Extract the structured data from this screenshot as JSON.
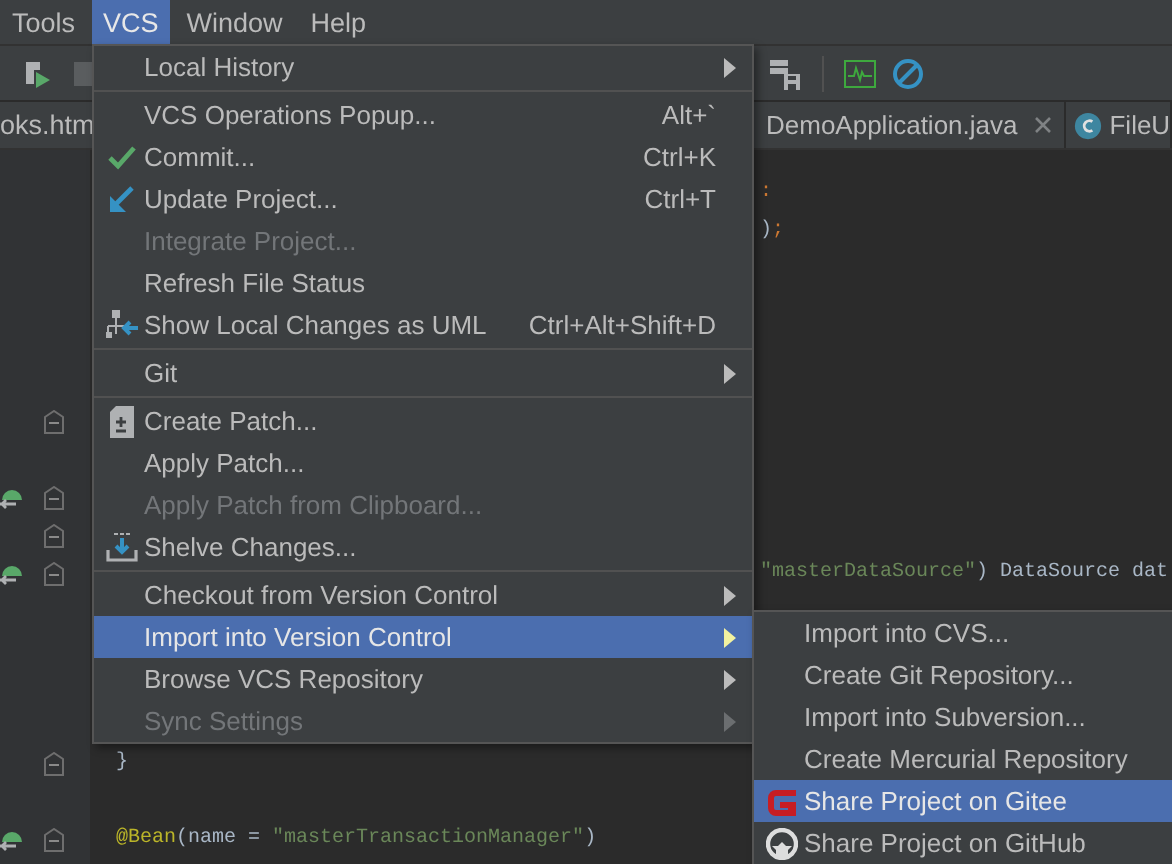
{
  "menubar": [
    {
      "label": "Tools",
      "selected": false
    },
    {
      "label": "VCS",
      "selected": true
    },
    {
      "label": "Window",
      "selected": false
    },
    {
      "label": "Help",
      "selected": false
    }
  ],
  "tabs": [
    {
      "label": "oks.htm",
      "selected": false,
      "kind": "file"
    },
    {
      "label": "DemoApplication.java",
      "selected": false,
      "closable": true,
      "kind": "file"
    },
    {
      "label": "FileU",
      "selected": false,
      "kind": "class"
    }
  ],
  "editor": {
    "lines": [
      {
        "kind": "plain",
        "right": [
          {
            "text": ":",
            "kind": "keyword"
          }
        ]
      },
      {
        "kind": "plain",
        "right": [
          {
            "text": ")",
            "kind": "plain"
          },
          {
            "text": ";",
            "kind": "keyword"
          }
        ]
      },
      {
        "kind": "plain"
      },
      {
        "kind": "plain"
      },
      {
        "kind": "plain"
      },
      {
        "kind": "plain"
      },
      {
        "kind": "fold"
      },
      {
        "kind": "plain"
      },
      {
        "kind": "bean"
      },
      {
        "kind": "fold"
      },
      {
        "kind": "bean",
        "right": [
          {
            "text": "\"masterDataSource\"",
            "kind": "string"
          },
          {
            "text": ") DataSource dat",
            "kind": "plain"
          }
        ]
      },
      {
        "kind": "plain"
      },
      {
        "kind": "plain"
      },
      {
        "kind": "plain"
      },
      {
        "kind": "plain"
      },
      {
        "kind": "fold",
        "left": [
          {
            "text": "}",
            "kind": "plain"
          }
        ]
      },
      {
        "kind": "plain"
      },
      {
        "kind": "bean",
        "left": [
          {
            "text": "@Bean",
            "kind": "annotation"
          },
          {
            "text": "(name = ",
            "kind": "plain"
          },
          {
            "text": "\"masterTransactionManager\"",
            "kind": "string"
          },
          {
            "text": ")",
            "kind": "plain"
          }
        ]
      }
    ]
  },
  "menu": {
    "items": [
      {
        "kind": "plain",
        "label": "Local History",
        "submenu": true,
        "disabled": false,
        "selected": false
      },
      {
        "kind": "separator"
      },
      {
        "kind": "plain",
        "label": "VCS Operations Popup...",
        "shortcut": "Alt+`",
        "submenu": false,
        "disabled": false,
        "selected": false
      },
      {
        "kind": "check",
        "label": "Commit...",
        "shortcut": "Ctrl+K",
        "submenu": false,
        "disabled": false,
        "selected": false
      },
      {
        "kind": "arrow",
        "label": "Update Project...",
        "shortcut": "Ctrl+T",
        "submenu": false,
        "disabled": false,
        "selected": false
      },
      {
        "kind": "plain",
        "label": "Integrate Project...",
        "submenu": false,
        "disabled": true,
        "selected": false
      },
      {
        "kind": "plain",
        "label": "Refresh File Status",
        "submenu": false,
        "disabled": false,
        "selected": false
      },
      {
        "kind": "diagram",
        "label": "Show Local Changes as UML",
        "shortcut": "Ctrl+Alt+Shift+D",
        "submenu": false,
        "disabled": false,
        "selected": false
      },
      {
        "kind": "separator"
      },
      {
        "kind": "plain",
        "label": "Git",
        "submenu": true,
        "disabled": false,
        "selected": false
      },
      {
        "kind": "separator"
      },
      {
        "kind": "patch",
        "label": "Create Patch...",
        "submenu": false,
        "disabled": false,
        "selected": false
      },
      {
        "kind": "plain",
        "label": "Apply Patch...",
        "submenu": false,
        "disabled": false,
        "selected": false
      },
      {
        "kind": "plain",
        "label": "Apply Patch from Clipboard...",
        "submenu": false,
        "disabled": true,
        "selected": false
      },
      {
        "kind": "shelve",
        "label": "Shelve Changes...",
        "submenu": false,
        "disabled": false,
        "selected": false
      },
      {
        "kind": "separator"
      },
      {
        "kind": "plain",
        "label": "Checkout from Version Control",
        "submenu": true,
        "disabled": false,
        "selected": false
      },
      {
        "kind": "plain",
        "label": "Import into Version Control",
        "submenu": true,
        "disabled": false,
        "selected": true
      },
      {
        "kind": "plain",
        "label": "Browse VCS Repository",
        "submenu": true,
        "disabled": false,
        "selected": false
      },
      {
        "kind": "plain",
        "label": "Sync Settings",
        "submenu": true,
        "disabled": true,
        "selected": false
      }
    ]
  },
  "submenu": {
    "items": [
      {
        "kind": "plain",
        "label": "Import into CVS...",
        "disabled": false,
        "selected": false
      },
      {
        "kind": "plain",
        "label": "Create Git Repository...",
        "disabled": false,
        "selected": false
      },
      {
        "kind": "plain",
        "label": "Import into Subversion...",
        "disabled": false,
        "selected": false
      },
      {
        "kind": "plain",
        "label": "Create Mercurial Repository",
        "disabled": false,
        "selected": false
      },
      {
        "kind": "gitee",
        "label": "Share Project on Gitee",
        "disabled": false,
        "selected": true
      },
      {
        "kind": "github",
        "label": "Share Project on GitHub",
        "disabled": false,
        "selected": false
      }
    ]
  }
}
